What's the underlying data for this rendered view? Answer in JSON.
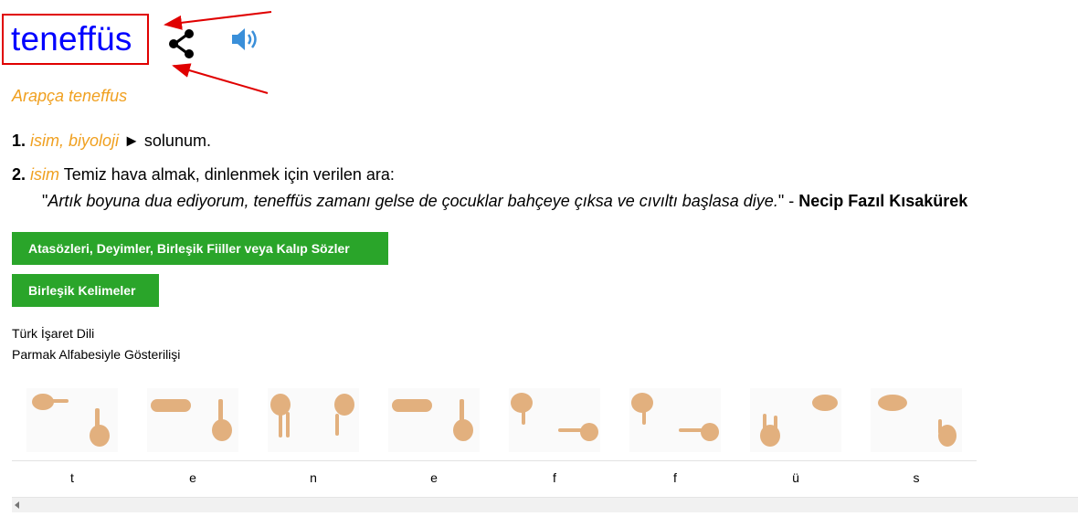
{
  "entry": {
    "headword": "teneffüs",
    "origin": "Arapça teneffus",
    "definitions": [
      {
        "num": "1.",
        "tags": "isim, biyoloji",
        "marker": "►",
        "text": "solunum."
      },
      {
        "num": "2.",
        "tags": "isim",
        "text": "Temiz hava almak, dinlenmek için verilen ara:"
      }
    ],
    "quote": {
      "open": "\"",
      "text": "Artık boyuna dua ediyorum, teneffüs zamanı gelse de çocuklar bahçeye çıksa ve cıvıltı başlasa diye.",
      "close": "\" - ",
      "author": "Necip Fazıl Kısakürek"
    }
  },
  "buttons": {
    "idioms": "Atasözleri, Deyimler, Birleşik Fiiller veya Kalıp Sözler",
    "compounds": "Birleşik Kelimeler"
  },
  "sign_language": {
    "title_line1": "Türk İşaret Dili",
    "title_line2": "Parmak Alfabesiyle Gösterilişi",
    "letters": [
      "t",
      "e",
      "n",
      "e",
      "f",
      "f",
      "ü",
      "s"
    ]
  },
  "icons": {
    "share": "share-icon",
    "speaker": "speaker-icon",
    "scroll_left": "scroll-left-arrow"
  },
  "colors": {
    "headword": "#0000ff",
    "tag": "#f0a020",
    "button": "#2aa52a",
    "annotation": "#e00000"
  }
}
